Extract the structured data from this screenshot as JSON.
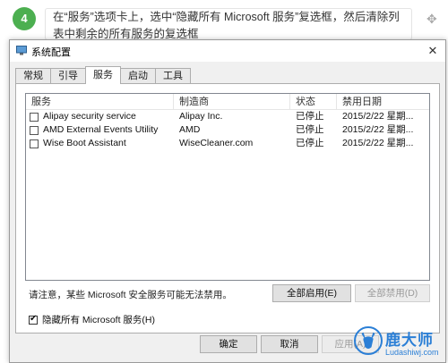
{
  "instruction": {
    "step": "4",
    "text": "在“服务”选项卡上，选中“隐藏所有 Microsoft 服务”复选框，然后清除列表中剩余的所有服务的复选框"
  },
  "dialog": {
    "title": "系统配置",
    "close_icon": "close-icon"
  },
  "tabs": [
    "常规",
    "引导",
    "服务",
    "启动",
    "工具"
  ],
  "active_tab": "服务",
  "services": {
    "columns": [
      "服务",
      "制造商",
      "状态",
      "禁用日期"
    ],
    "rows": [
      {
        "name": "Alipay security service",
        "vendor": "Alipay Inc.",
        "status": "已停止",
        "date": "2015/2/22 星期..."
      },
      {
        "name": "AMD External Events Utility",
        "vendor": "AMD",
        "status": "已停止",
        "date": "2015/2/22 星期..."
      },
      {
        "name": "Wise Boot Assistant",
        "vendor": "WiseCleaner.com",
        "status": "已停止",
        "date": "2015/2/22 星期..."
      }
    ]
  },
  "notice": "请注意，某些 Microsoft 安全服务可能无法禁用。",
  "buttons": {
    "enable_all": "全部启用(E)",
    "disable_all": "全部禁用(D)",
    "ok": "确定",
    "cancel": "取消",
    "apply": "应用(A)"
  },
  "hide_ms": {
    "label": "隐藏所有 Microsoft 服务(H)",
    "checked": true
  },
  "watermark": {
    "title": "鹿大师",
    "subtitle": "Ludashiwj.com"
  },
  "colors": {
    "step_badge": "#4caf50",
    "watermark": "#2b7fd6"
  }
}
